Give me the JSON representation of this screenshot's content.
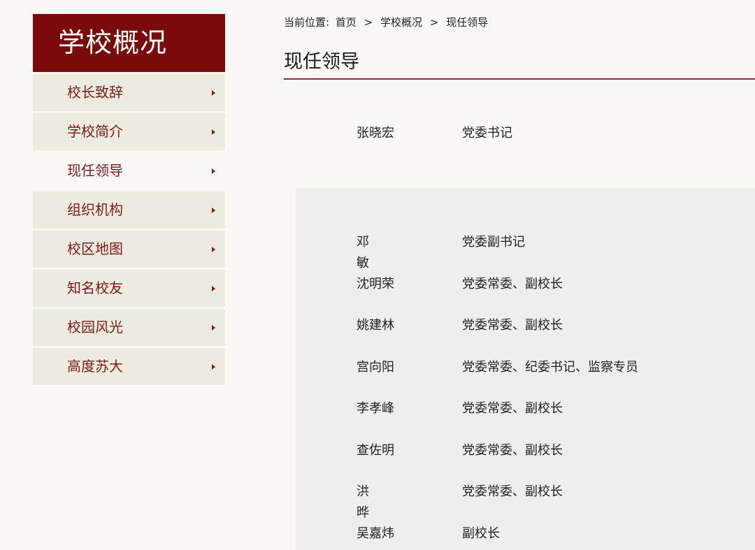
{
  "sidebar": {
    "title": "学校概况",
    "items": [
      {
        "label": "校长致辞",
        "active": false
      },
      {
        "label": "学校简介",
        "active": false
      },
      {
        "label": "现任领导",
        "active": true
      },
      {
        "label": "组织机构",
        "active": false
      },
      {
        "label": "校区地图",
        "active": false
      },
      {
        "label": "知名校友",
        "active": false
      },
      {
        "label": "校园风光",
        "active": false
      },
      {
        "label": "高度苏大",
        "active": false
      }
    ]
  },
  "breadcrumb": {
    "prefix": "当前位置:",
    "items": [
      "首页",
      "学校概况",
      "现任领导"
    ],
    "separator": ">"
  },
  "page_title": "现任领导",
  "leaders_primary": [
    {
      "name": "张晓宏",
      "role": "党委书记"
    }
  ],
  "leaders": [
    {
      "name": "邓 敏",
      "role": "党委副书记"
    },
    {
      "name": "沈明荣",
      "role": "党委常委、副校长"
    },
    {
      "name": "姚建林",
      "role": "党委常委、副校长"
    },
    {
      "name": "宫向阳",
      "role": "党委常委、纪委书记、监察专员"
    },
    {
      "name": "李孝峰",
      "role": "党委常委、副校长"
    },
    {
      "name": "查佐明",
      "role": "党委常委、副校长"
    },
    {
      "name": "洪 晔",
      "role": "党委常委、副校长"
    },
    {
      "name": "吴嘉炜",
      "role": "副校长"
    }
  ],
  "colors": {
    "brand": "#7b0a0a",
    "accent_rule": "#a0282a",
    "sidebar_item_bg": "#edeae0",
    "sidebar_item_text": "#7b1a1a",
    "panel_bg": "#eeeeee",
    "page_bg": "#f9f8f5"
  },
  "icons": {
    "sidebar_item_arrow": "caret-right-icon"
  }
}
